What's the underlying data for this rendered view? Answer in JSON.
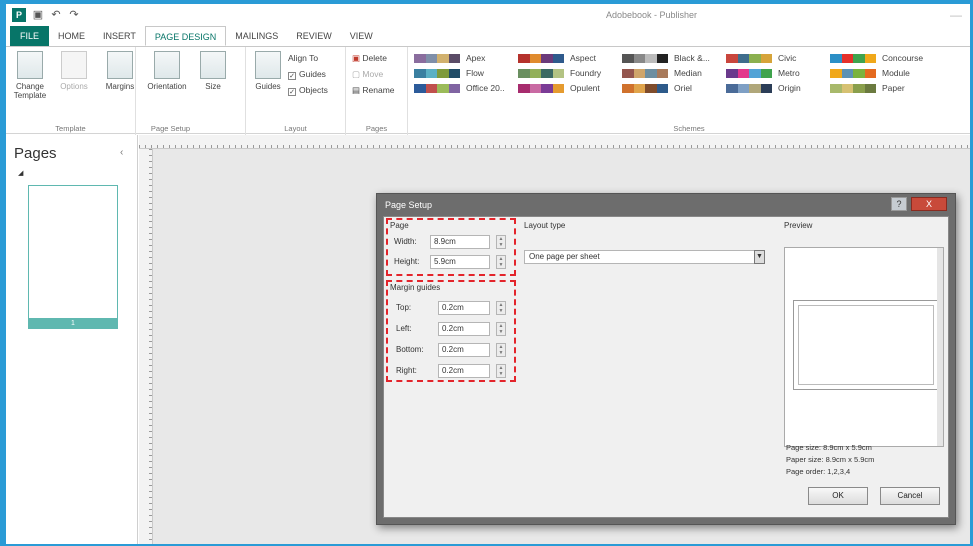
{
  "app": {
    "title": "Adobebook - Publisher",
    "qat_icons": [
      "save-icon",
      "undo-icon",
      "redo-icon"
    ]
  },
  "tabs": [
    {
      "label": "FILE"
    },
    {
      "label": "HOME"
    },
    {
      "label": "INSERT"
    },
    {
      "label": "PAGE DESIGN"
    },
    {
      "label": "MAILINGS"
    },
    {
      "label": "REVIEW"
    },
    {
      "label": "VIEW"
    }
  ],
  "ribbon": {
    "template": {
      "change": "Change Template",
      "options": "Options",
      "group": "Template"
    },
    "page_setup": {
      "margins": "Margins",
      "orientation": "Orientation",
      "size": "Size",
      "group": "Page Setup"
    },
    "layout": {
      "guides": "Guides",
      "align_to": "Align To",
      "guides_chk": "Guides",
      "objects_chk": "Objects",
      "group": "Layout"
    },
    "pages": {
      "delete": "Delete",
      "move": "Move",
      "rename": "Rename",
      "group": "Pages"
    },
    "schemes": {
      "group": "Schemes",
      "items": [
        {
          "name": "Apex",
          "colors": [
            "#8a6d9e",
            "#7f8fa9",
            "#d1b16e",
            "#5b4c67"
          ]
        },
        {
          "name": "Flow",
          "colors": [
            "#3a7fa0",
            "#5bb0c4",
            "#7e9a3c",
            "#214c67"
          ]
        },
        {
          "name": "Office 20..",
          "colors": [
            "#2c5b9a",
            "#c0504d",
            "#9bbb59",
            "#8064a2"
          ]
        },
        {
          "name": "Aspect",
          "colors": [
            "#b5322c",
            "#e08b2e",
            "#6b3a7a",
            "#2f5a8c"
          ]
        },
        {
          "name": "Foundry",
          "colors": [
            "#6a8f60",
            "#93b05a",
            "#3c6a63",
            "#b3c383"
          ]
        },
        {
          "name": "Opulent",
          "colors": [
            "#a72c6e",
            "#c96aa3",
            "#7b3b96",
            "#e59b2f"
          ]
        },
        {
          "name": "Black &...",
          "colors": [
            "#555555",
            "#888888",
            "#bbbbbb",
            "#222222"
          ]
        },
        {
          "name": "Median",
          "colors": [
            "#94564e",
            "#cfa56a",
            "#6d8ea0",
            "#a87a5b"
          ]
        },
        {
          "name": "Oriel",
          "colors": [
            "#d0722d",
            "#e0a44b",
            "#7f4c2b",
            "#2d5a8a"
          ]
        },
        {
          "name": "Civic",
          "colors": [
            "#c9463d",
            "#3f6d8c",
            "#8bb04f",
            "#d6a43a"
          ]
        },
        {
          "name": "Metro",
          "colors": [
            "#6a3a8c",
            "#e3388c",
            "#52a3d6",
            "#3fa34d"
          ]
        },
        {
          "name": "Origin",
          "colors": [
            "#4a6b98",
            "#7e9fc4",
            "#b0a77a",
            "#2b3d57"
          ]
        },
        {
          "name": "Concourse",
          "colors": [
            "#2b8fc6",
            "#e5302a",
            "#3fa34d",
            "#f0a81a"
          ]
        },
        {
          "name": "Module",
          "colors": [
            "#f0a81a",
            "#5c92b4",
            "#7ab33d",
            "#e46a1f"
          ]
        },
        {
          "name": "Paper",
          "colors": [
            "#a8b96b",
            "#d6c172",
            "#8a9f4c",
            "#6b7a3f"
          ]
        }
      ]
    }
  },
  "pages_pane": {
    "title": "Pages",
    "thumb_label": "1"
  },
  "dialog": {
    "title": "Page Setup",
    "help": "?",
    "close": "X",
    "page_section": "Page",
    "width_label": "Width:",
    "width_value": "8.9cm",
    "height_label": "Height:",
    "height_value": "5.9cm",
    "layout_type_label": "Layout type",
    "layout_type_value": "One page per sheet",
    "margin_section": "Margin guides",
    "top_label": "Top:",
    "top_value": "0.2cm",
    "left_label": "Left:",
    "left_value": "0.2cm",
    "bottom_label": "Bottom:",
    "bottom_value": "0.2cm",
    "right_label": "Right:",
    "right_value": "0.2cm",
    "preview_label": "Preview",
    "page_size": "Page size: 8.9cm x 5.9cm",
    "paper_size": "Paper size: 8.9cm x 5.9cm",
    "page_order": "Page order: 1,2,3,4",
    "ok": "OK",
    "cancel": "Cancel"
  },
  "colors": {
    "accent": "#077568",
    "highlight": "#e3242b",
    "frame": "#2a9bd6"
  }
}
